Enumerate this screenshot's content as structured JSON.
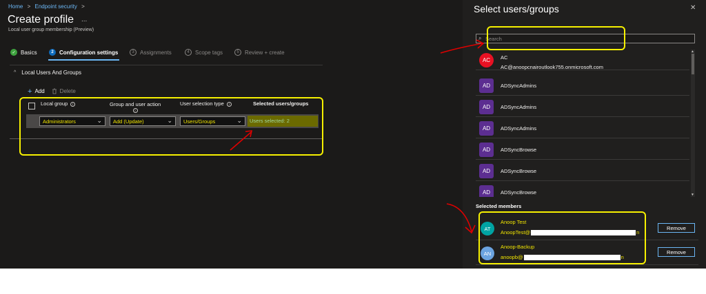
{
  "breadcrumb": [
    "Home",
    "Endpoint security"
  ],
  "page": {
    "title": "Create profile",
    "more": "...",
    "subtitle": "Local user group membership (Preview)"
  },
  "steps": [
    {
      "num": "✓",
      "label": "Basics",
      "state": "done"
    },
    {
      "num": "2",
      "label": "Configuration settings",
      "state": "active"
    },
    {
      "num": "3",
      "label": "Assignments",
      "state": "pending"
    },
    {
      "num": "4",
      "label": "Scope tags",
      "state": "pending"
    },
    {
      "num": "5",
      "label": "Review + create",
      "state": "pending"
    }
  ],
  "section": {
    "chevron": "^",
    "label": "Local Users And Groups"
  },
  "toolbar": {
    "add_label": "Add",
    "delete_label": "Delete"
  },
  "table": {
    "headers": {
      "local_group": "Local group",
      "group_action": "Group and user action",
      "user_selection": "User selection type",
      "selected_users": "Selected users/groups"
    },
    "row": {
      "local_group": "Administrators",
      "group_action": "Add (Update)",
      "user_selection": "Users/Groups",
      "selected_users": "Users selected: 2"
    }
  },
  "panel": {
    "title": "Select users/groups",
    "search_placeholder": "Search",
    "results": [
      {
        "initials": "AC",
        "name": "AC",
        "email": "AC@anoopcnairoutlook755.onmicrosoft.com"
      },
      {
        "initials": "AD",
        "name": "ADSyncAdmins"
      },
      {
        "initials": "AD",
        "name": "ADSyncAdmins"
      },
      {
        "initials": "AD",
        "name": "ADSyncAdmins"
      },
      {
        "initials": "AD",
        "name": "ADSyncBrowse"
      },
      {
        "initials": "AD",
        "name": "ADSyncBrowse"
      },
      {
        "initials": "AD",
        "name": "ADSyncBrowse"
      }
    ],
    "selected_label": "Selected members",
    "members": [
      {
        "initials": "AT",
        "name": "Anoop Test",
        "email_prefix": "AnoopTest@",
        "email_suffix": "n",
        "remove_label": "Remove",
        "avatar_color": "#00a3a3"
      },
      {
        "initials": "AN",
        "name": "Anoop-Backup",
        "email_prefix": "anoopb@",
        "email_suffix": "n",
        "remove_label": "Remove",
        "avatar_color": "#6ba3e0"
      }
    ]
  },
  "colors": {
    "accent": "#6cb8f6",
    "highlight_yellow": "#f7f100",
    "annotation_red": "#e00000"
  }
}
